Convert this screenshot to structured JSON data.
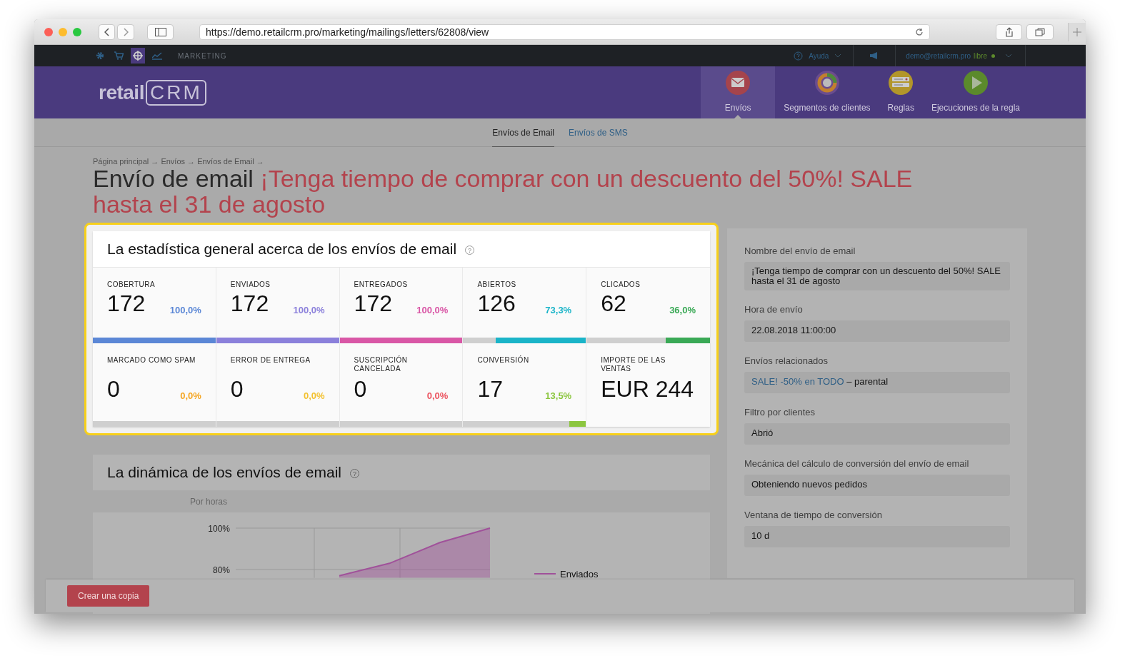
{
  "browser": {
    "url": "https://demo.retailcrm.pro/marketing/mailings/letters/62808/view"
  },
  "top_nav": {
    "section": "MARKETING",
    "help": "Ayuda",
    "user": "demo@retailcrm.pro",
    "plan": "libre"
  },
  "logo": {
    "word": "retail",
    "mark": "CRM"
  },
  "modules": [
    {
      "label": "Envíos",
      "selected": true,
      "kind": "envelope"
    },
    {
      "label": "Segmentos de clientes",
      "selected": false,
      "kind": "segments"
    },
    {
      "label": "Reglas",
      "selected": false,
      "kind": "rules"
    },
    {
      "label": "Ejecuciones de la regla",
      "selected": false,
      "kind": "play"
    }
  ],
  "subtabs": [
    {
      "label": "Envíos de Email",
      "selected": true
    },
    {
      "label": "Envíos de SMS",
      "selected": false
    }
  ],
  "breadcrumb": "Página principal → Envíos → Envíos de Email →",
  "title": {
    "prefix": "Envío de email",
    "name": "¡Tenga tiempo de comprar con un descuento del 50%! SALE hasta el 31 de agosto"
  },
  "stats": {
    "title": "La estadística general acerca de los envíos de email",
    "help": "?",
    "items": [
      {
        "label": "COBERTURA",
        "value": "172",
        "percent": "100,0%",
        "level": 1,
        "color": "#5b87d6"
      },
      {
        "label": "ENVIADOS",
        "value": "172",
        "percent": "100,0%",
        "level": 1,
        "color": "#8b80db"
      },
      {
        "label": "ENTREGADOS",
        "value": "172",
        "percent": "100,0%",
        "level": 1,
        "color": "#d957a6"
      },
      {
        "label": "ABIERTOS",
        "value": "126",
        "percent": "73,3%",
        "level": 0.733,
        "color": "#1ab4c8"
      },
      {
        "label": "CLICADOS",
        "value": "62",
        "percent": "36,0%",
        "level": 0.36,
        "color": "#3aa956"
      },
      {
        "label": "MARCADO COMO SPAM",
        "value": "0",
        "percent": "0,0%",
        "color": "#f5a623"
      },
      {
        "label": "ERROR DE ENTREGA",
        "value": "0",
        "percent": "0,0%",
        "color": "#f3c12f"
      },
      {
        "label": "SUSCRIPCIÓN CANCELADA",
        "value": "0",
        "percent": "0,0%",
        "color": "#ec5561"
      },
      {
        "label": "CONVERSIÓN",
        "value": "17",
        "percent": "13,5%",
        "level": 0.135,
        "color": "#8cc63f"
      },
      {
        "label": "IMPORTE DE LAS VENTAS",
        "value": "EUR 244"
      }
    ]
  },
  "dynamics": {
    "title": "La dinámica de los envíos de email",
    "help": "?",
    "period": "Por horas",
    "chart_data": {
      "type": "area",
      "ylim": [
        76,
        100
      ],
      "yticks": [
        {
          "value": 80,
          "label": "80%"
        },
        {
          "value": 100,
          "label": "100%"
        }
      ],
      "series": [
        {
          "name": "Enviados",
          "color": "#a0519a",
          "values": [
            77,
            83,
            93,
            100
          ]
        }
      ]
    }
  },
  "details": [
    {
      "label": "Nombre del envío de email",
      "value": "¡Tenga tiempo de comprar con un descuento del 50%! SALE hasta el 31 de agosto"
    },
    {
      "label": "Hora de envío",
      "value": "22.08.2018 11:00:00"
    },
    {
      "label": "Envíos relacionados",
      "link": "SALE! -50% en TODO",
      "value": "– parental"
    },
    {
      "label": "Filtro por clientes",
      "value": "Abrió"
    },
    {
      "label": "Mecánica del cálculo de conversión del envío de email",
      "value": "Obteniendo nuevos pedidos"
    },
    {
      "label": "Ventana de tiempo de conversión",
      "value": "10 d"
    }
  ],
  "footer": {
    "button": "Crear una copia"
  }
}
